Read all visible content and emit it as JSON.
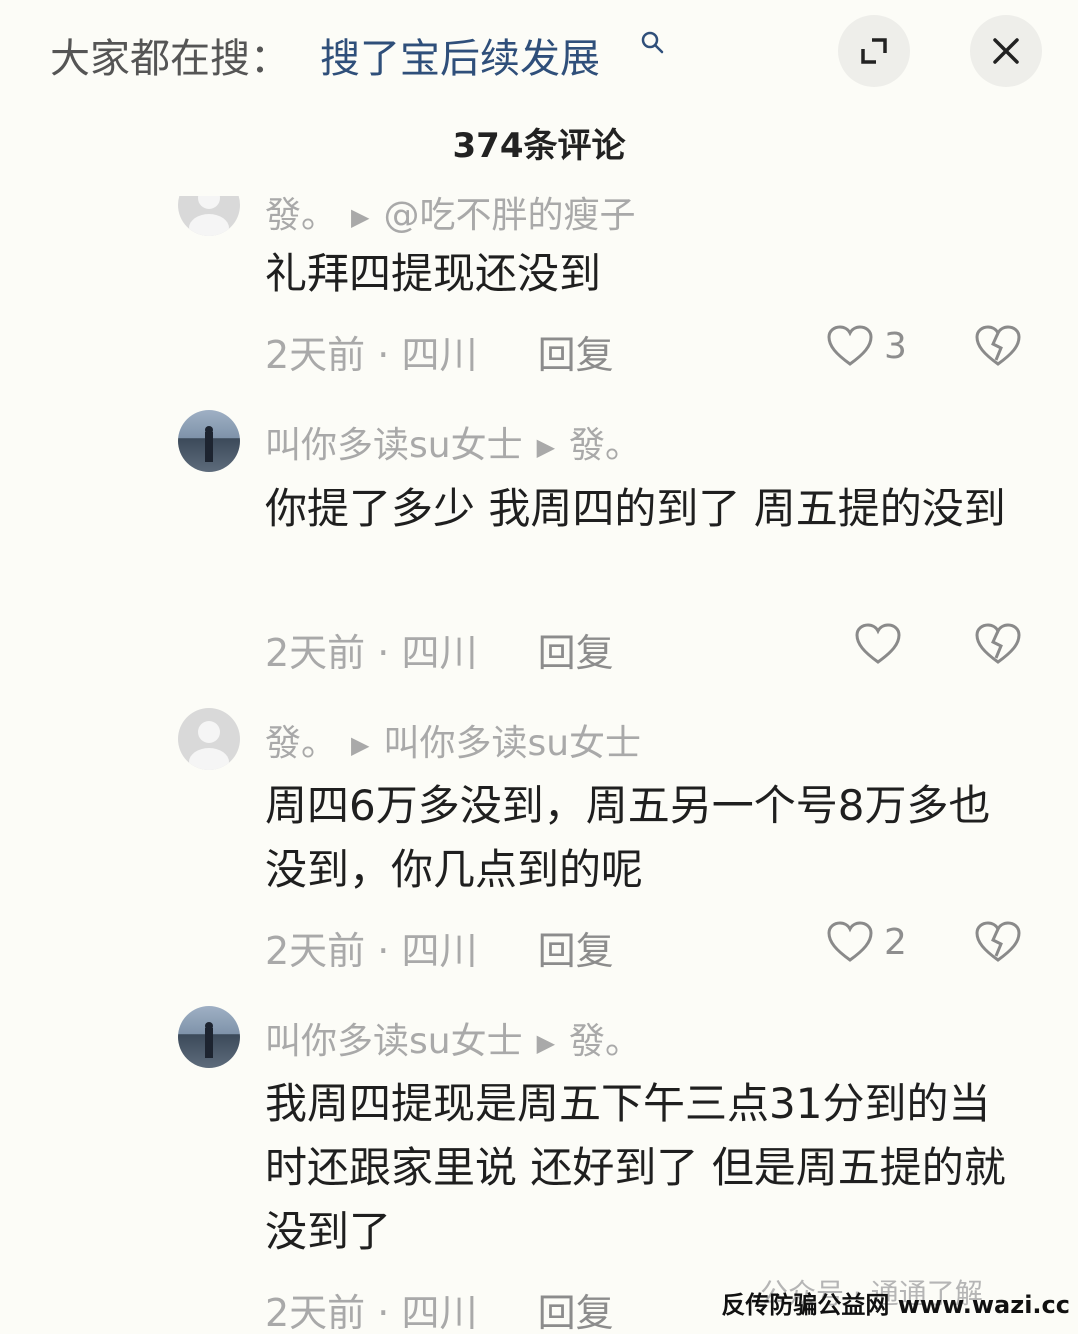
{
  "search": {
    "prefix": "大家都在搜：",
    "query": "搜了宝后续发展"
  },
  "header": {
    "comment_count": "374条评论"
  },
  "comments": [
    {
      "user": "發。",
      "reply_to": "@吃不胖的瘦子",
      "text": "礼拜四提现还没到",
      "time": "2天前",
      "location": "四川",
      "reply_label": "回复",
      "likes": "3"
    },
    {
      "user": "叫你多读su女士",
      "reply_to": "發。",
      "text": "你提了多少   我周四的到了   周五提的没到",
      "time": "2天前",
      "location": "四川",
      "reply_label": "回复",
      "likes": ""
    },
    {
      "user": "發。",
      "reply_to": "叫你多读su女士",
      "text": "周四6万多没到，周五另一个号8万多也没到，你几点到的呢",
      "time": "2天前",
      "location": "四川",
      "reply_label": "回复",
      "likes": "2"
    },
    {
      "user": "叫你多读su女士",
      "reply_to": "發。",
      "text": "我周四提现是周五下午三点31分到的当时还跟家里说  还好到了   但是周五提的就没到了",
      "time": "2天前",
      "location": "四川",
      "reply_label": "回复",
      "likes": ""
    }
  ],
  "meta_separator": "·",
  "watermark": "公众号 · 通通了解",
  "site_tag": "反传防骗公益网 www.wazi.cc",
  "colors": {
    "background": "#fcfcf7",
    "search_query": "#2f4f7a",
    "muted": "#a9a9a9",
    "text": "#1f1f1f"
  },
  "icons": [
    "search-icon",
    "expand-icon",
    "close-icon",
    "heart-icon",
    "broken-heart-icon",
    "play-arrow-icon"
  ]
}
